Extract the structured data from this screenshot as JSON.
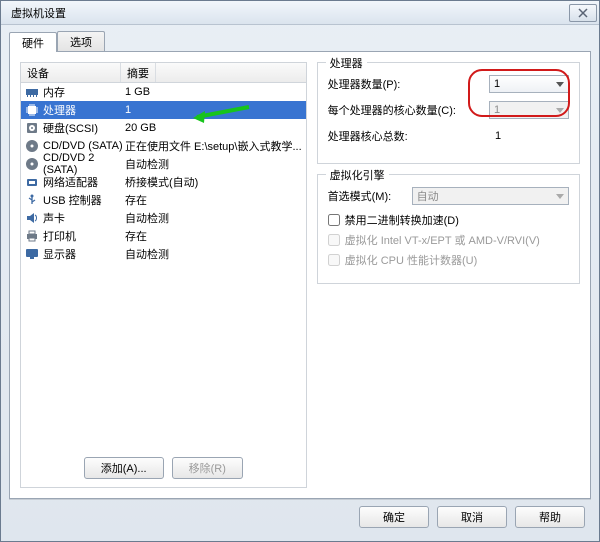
{
  "window": {
    "title": "虚拟机设置",
    "close": "×"
  },
  "tabs": {
    "hardware": "硬件",
    "options": "选项"
  },
  "columns": {
    "device": "设备",
    "summary": "摘要"
  },
  "devices": [
    {
      "name": "内存",
      "summary": "1 GB",
      "icon": "memory"
    },
    {
      "name": "处理器",
      "summary": "1",
      "icon": "cpu",
      "selected": true
    },
    {
      "name": "硬盘(SCSI)",
      "summary": "20 GB",
      "icon": "disk"
    },
    {
      "name": "CD/DVD (SATA)",
      "summary": "正在使用文件 E:\\setup\\嵌入式教学...",
      "icon": "cd"
    },
    {
      "name": "CD/DVD 2 (SATA)",
      "summary": "自动检测",
      "icon": "cd"
    },
    {
      "name": "网络适配器",
      "summary": "桥接模式(自动)",
      "icon": "net"
    },
    {
      "name": "USB 控制器",
      "summary": "存在",
      "icon": "usb"
    },
    {
      "name": "声卡",
      "summary": "自动检测",
      "icon": "sound"
    },
    {
      "name": "打印机",
      "summary": "存在",
      "icon": "printer"
    },
    {
      "name": "显示器",
      "summary": "自动检测",
      "icon": "display"
    }
  ],
  "left_buttons": {
    "add": "添加(A)...",
    "remove": "移除(R)"
  },
  "processors_group": {
    "title": "处理器",
    "count_label": "处理器数量(P):",
    "count_value": "1",
    "cores_label": "每个处理器的核心数量(C):",
    "cores_value": "1",
    "total_label": "处理器核心总数:",
    "total_value": "1"
  },
  "virt_group": {
    "title": "虚拟化引擎",
    "mode_label": "首选模式(M):",
    "mode_value": "自动",
    "chk1": "禁用二进制转换加速(D)",
    "chk2": "虚拟化 Intel VT-x/EPT 或 AMD-V/RVI(V)",
    "chk3": "虚拟化 CPU 性能计数器(U)"
  },
  "buttons": {
    "ok": "确定",
    "cancel": "取消",
    "help": "帮助"
  }
}
